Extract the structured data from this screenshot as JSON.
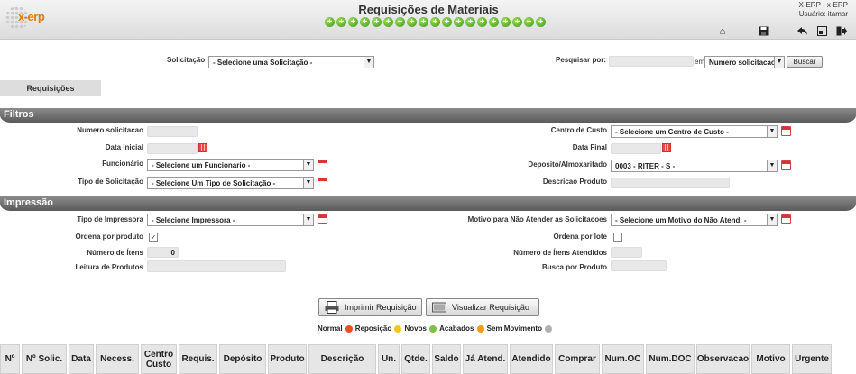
{
  "header": {
    "logo_text": "x-erp",
    "title": "Requisições de Materiais",
    "plus_count": 19,
    "app_user": "X-ERP - x-ERP",
    "user_label": "Usuário: itamar"
  },
  "toolbar": {
    "solicitacao_label": "Solicitação",
    "solicitacao_value": "- Selecione uma Solicitação -",
    "pesquisar_label": "Pesquisar por:",
    "pesquisar_value": "",
    "em_label": "em",
    "pesquisar_field": "Numero solicitacao",
    "buscar_label": "Buscar"
  },
  "tab": {
    "label": "Requisições"
  },
  "filtros": {
    "title": "Filtros",
    "numero_solicitacao_label": "Numero solicitacao",
    "numero_solicitacao_value": "",
    "data_inicial_label": "Data Inicial",
    "data_inicial_value": "",
    "funcionario_label": "Funcionário",
    "funcionario_value": "- Selecione um Funcionario -",
    "tipo_solicitacao_label": "Tipo de Solicitação",
    "tipo_solicitacao_value": "- Selecione Um Tipo de Solicitação -",
    "centro_custo_label": "Centro de Custo",
    "centro_custo_value": "- Selecione um Centro de Custo -",
    "data_final_label": "Data Final",
    "data_final_value": "",
    "deposito_label": "Deposito/Almoxarifado",
    "deposito_value": "0003 - RITER - S -",
    "descricao_produto_label": "Descricao Produto",
    "descricao_produto_value": ""
  },
  "impressao": {
    "title": "Impressão",
    "tipo_impressora_label": "Tipo de Impressora",
    "tipo_impressora_value": "- Selecione Impressora -",
    "ordena_produto_label": "Ordena por produto",
    "ordena_produto_checked": "✓",
    "numero_itens_label": "Número de Ítens",
    "numero_itens_value": "0",
    "leitura_produtos_label": "Leitura de Produtos",
    "motivo_label": "Motivo para Não Atender as Solicitacoes",
    "motivo_value": "- Selecione um Motivo do Não Atend. -",
    "ordena_lote_label": "Ordena por lote",
    "numero_itens_atendidos_label": "Número de Ítens Atendidos",
    "busca_produto_label": "Busca por Produto"
  },
  "actions": {
    "imprimir_label": "Imprimir Requisição",
    "visualizar_label": "Visualizar Requisição"
  },
  "legend": {
    "items": [
      {
        "label": "Normal",
        "color": "#e8501c"
      },
      {
        "label": "Reposição",
        "color": "#f5c518"
      },
      {
        "label": "Novos",
        "color": "#7cc243"
      },
      {
        "label": "Acabados",
        "color": "#f59a1b"
      },
      {
        "label": "Sem Movimento",
        "color": "#b0b0b0"
      }
    ]
  },
  "table": {
    "columns": [
      "Nº",
      "Nº Solic.",
      "Data",
      "Necess.",
      "Centro Custo",
      "Requis.",
      "Depósito",
      "Produto",
      "Descrição",
      "Un.",
      "Qtde.",
      "Saldo",
      "Já Atend.",
      "Atendido",
      "Comprar",
      "Num.OC",
      "Num.DOC",
      "Observacao",
      "Motivo",
      "Urgente"
    ]
  }
}
